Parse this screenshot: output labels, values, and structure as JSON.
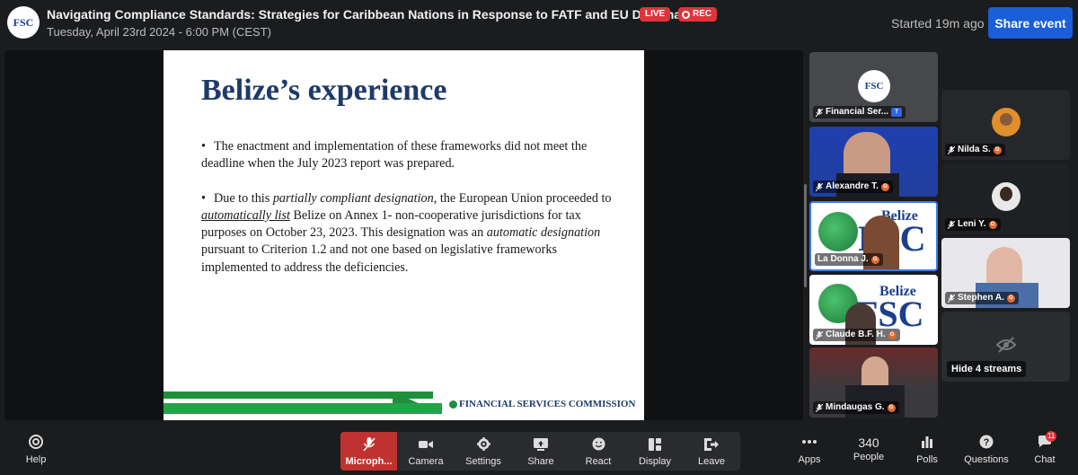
{
  "header": {
    "logo_text": "FSC",
    "title": "Navigating Compliance Standards: Strategies for Caribbean Nations in Response to FATF and EU Designations",
    "datetime": "Tuesday, April 23rd 2024 - 6:00 PM (CEST)",
    "live_label": "LIVE",
    "rec_label": "REC",
    "started_text": "Started 19m ago",
    "share_label": "Share event"
  },
  "slide": {
    "title": "Belize’s experience",
    "bullet1": "The enactment and implementation of these frameworks did not meet the deadline when the July 2023 report was prepared.",
    "bullet2_pre": "Due to this ",
    "bullet2_em1": "partially compliant designation,",
    "bullet2_mid1": " the European Union proceeded to ",
    "bullet2_em2": "automatically list",
    "bullet2_mid2": " Belize on  Annex 1- non-cooperative jurisdictions for tax purposes on October 23, 2023. This designation was an ",
    "bullet2_em3": "automatic designation",
    "bullet2_end": " pursuant to Criterion 1.2 and not one based on legislative frameworks implemented to address the deficiencies.",
    "footer": "FINANCIAL SERVICES COMMISSION"
  },
  "participants": [
    {
      "name": "Financial Ser...",
      "badge": "T"
    },
    {
      "name": "Alexandre T.",
      "badge": "G"
    },
    {
      "name": "La Donna J.",
      "badge": "G"
    },
    {
      "name": "Claude B.F. H.",
      "badge": "G"
    },
    {
      "name": "Mindaugas G.",
      "badge": "G"
    },
    {
      "name": "Nilda S.",
      "badge": "G"
    },
    {
      "name": "Leni Y.",
      "badge": "G"
    },
    {
      "name": "Stephen A.",
      "badge": "G"
    }
  ],
  "tile_logo": {
    "brand": "Belize",
    "abbr": "FSC"
  },
  "hide_streams_label": "Hide 4 streams",
  "toolbar": {
    "help": "Help",
    "microphone": "Microph...",
    "camera": "Camera",
    "settings": "Settings",
    "share": "Share",
    "react": "React",
    "display": "Display",
    "leave": "Leave",
    "apps": "Apps",
    "people": "People",
    "people_count": "340",
    "polls": "Polls",
    "questions": "Questions",
    "chat": "Chat",
    "chat_badge": "11"
  },
  "colors": {
    "accent_blue": "#1a5ed8",
    "live_red": "#e0333a",
    "slide_title": "#1e3a6b",
    "fsc_green": "#1e8f3c"
  }
}
